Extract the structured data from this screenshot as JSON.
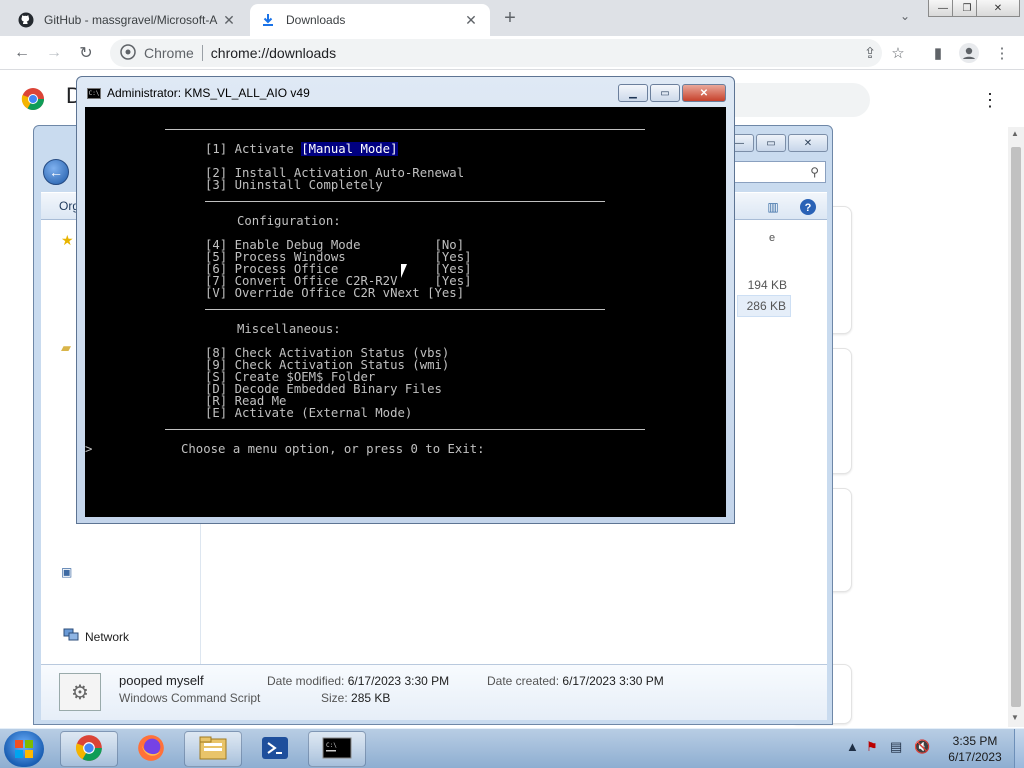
{
  "browser": {
    "tabs": [
      {
        "title": "GitHub - massgravel/Microsoft-A",
        "favicon": "github-icon",
        "active": false
      },
      {
        "title": "Downloads",
        "favicon": "download-icon",
        "active": true
      }
    ],
    "omnibox": {
      "site_label": "Chrome",
      "url": "chrome://downloads"
    },
    "downloads_header_initial": "D"
  },
  "explorer": {
    "organize_label": "Org",
    "nav_network": "Network",
    "col_header_fragment": "e",
    "file_sizes": [
      "194 KB",
      "286 KB"
    ],
    "details": {
      "name": "pooped myself",
      "type": "Windows Command Script",
      "date_modified_label": "Date modified:",
      "date_modified": "6/17/2023 3:30 PM",
      "date_created_label": "Date created:",
      "date_created": "6/17/2023 3:30 PM",
      "size_label": "Size:",
      "size": "285 KB"
    }
  },
  "console": {
    "title": "Administrator:  KMS_VL_ALL_AIO v49",
    "lines": {
      "activate_prefix": "[1] Activate ",
      "activate_mode": "[Manual Mode]",
      "opt2": "[2] Install Activation Auto-Renewal",
      "opt3": "[3] Uninstall Completely",
      "config_header": "Configuration:",
      "opt4": "[4] Enable Debug Mode          [No]",
      "opt5": "[5] Process Windows            [Yes]",
      "opt6": "[6] Process Office             [Yes]",
      "opt7": "[7] Convert Office C2R-R2V     [Yes]",
      "optV": "[V] Override Office C2R vNext [Yes]",
      "misc_header": "Miscellaneous:",
      "opt8": "[8] Check Activation Status (vbs)",
      "opt9": "[9] Check Activation Status (wmi)",
      "optS": "[S] Create $OEM$ Folder",
      "optD": "[D] Decode Embedded Binary Files",
      "optR": "[R] Read Me",
      "optE": "[E] Activate (External Mode)",
      "prompt": "Choose a menu option, or press 0 to Exit:",
      "caret": ">"
    }
  },
  "taskbar": {
    "apps": [
      "chrome-icon",
      "firefox-icon",
      "file-explorer-icon",
      "powershell-icon",
      "command-prompt-icon"
    ],
    "clock_time": "3:35 PM",
    "clock_date": "6/17/2023"
  },
  "colors": {
    "console_bg": "#000000",
    "console_fg": "#c0c0c0",
    "console_highlight_bg": "#000080",
    "taskbar": "#a3bfdc",
    "chrome_tabstrip": "#dee1e6"
  }
}
